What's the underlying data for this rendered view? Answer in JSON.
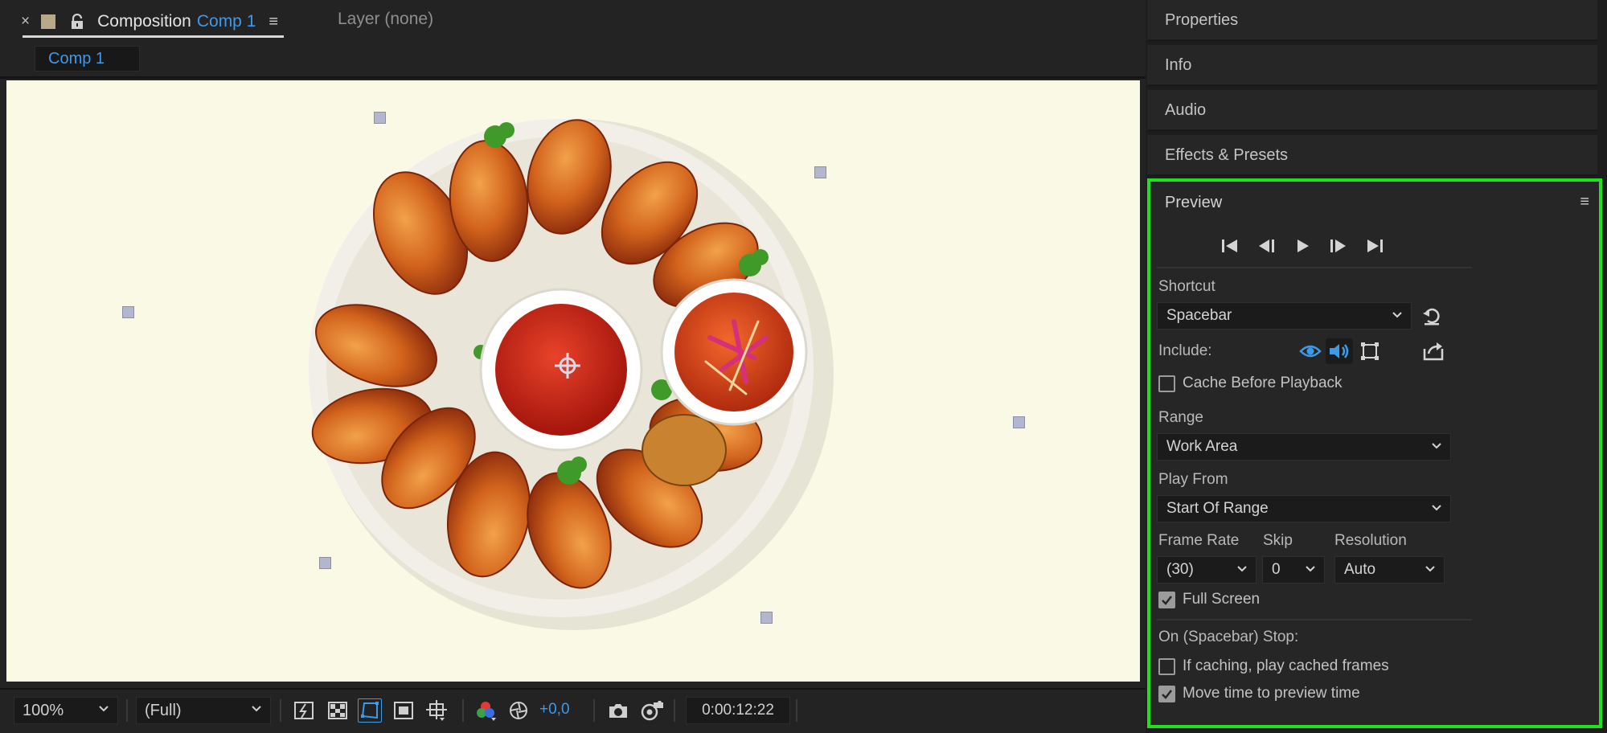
{
  "composition_panel": {
    "close_glyph": "×",
    "tab_title": "Composition",
    "tab_comp_name": "Comp 1",
    "menu_glyph": "≡",
    "layer_tab": "Layer (none)",
    "subtab": "Comp 1"
  },
  "viewer": {
    "background": "#faf9e6"
  },
  "viewer_toolbar": {
    "zoom": "100%",
    "resolution": "(Full)",
    "exposure": "+0,0",
    "timecode": "0:00:12:22"
  },
  "right_panels": {
    "properties": "Properties",
    "info": "Info",
    "audio": "Audio",
    "effects_presets": "Effects & Presets"
  },
  "preview": {
    "title": "Preview",
    "menu_glyph": "≡",
    "highlight_color": "#1fe21f",
    "shortcut_label": "Shortcut",
    "shortcut_value": "Spacebar",
    "include_label": "Include:",
    "cache_before_playback": {
      "label": "Cache Before Playback",
      "checked": false
    },
    "range_label": "Range",
    "range_value": "Work Area",
    "play_from_label": "Play From",
    "play_from_value": "Start Of Range",
    "frame_rate_label": "Frame Rate",
    "frame_rate_value": "(30)",
    "skip_label": "Skip",
    "skip_value": "0",
    "resolution_label": "Resolution",
    "resolution_value": "Auto",
    "full_screen": {
      "label": "Full Screen",
      "checked": true
    },
    "on_stop_label": "On (Spacebar) Stop:",
    "if_caching": {
      "label": "If caching, play cached frames",
      "checked": false
    },
    "move_time": {
      "label": "Move time to preview time",
      "checked": true
    }
  },
  "accent_color": "#3d9ae8"
}
